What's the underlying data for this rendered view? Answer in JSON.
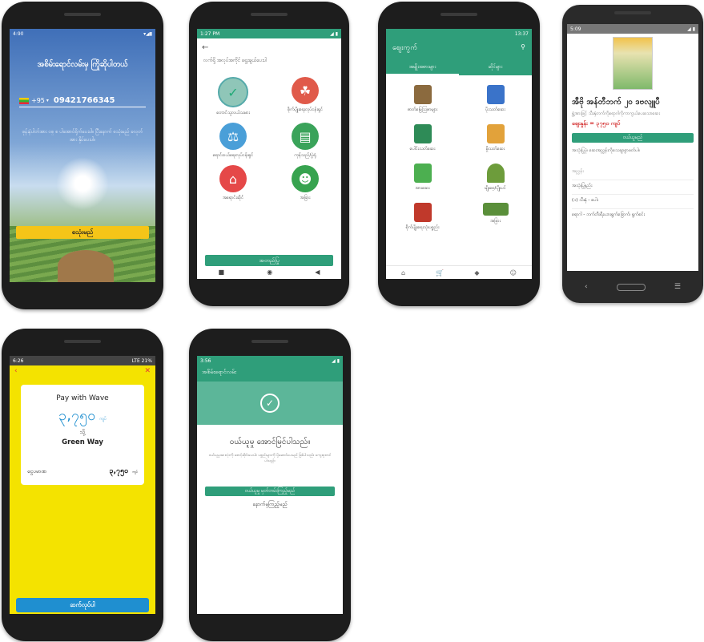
{
  "login": {
    "status_time": "4:90",
    "title": "အစိမ်းရောင်လမ်းမှ ကြိုဆိုပါတယ်",
    "country_code": "+95",
    "phone_number": "09421766345",
    "instructions": "ဖုန်းနံပါတ်အား ဝစ္ စ ပါအောင်ရိုက်ပေးပါ။ ပြီးနောက် စသုံးမည် ခလုတ်အား နှိပ်ပေးပါ။",
    "start_button": "စသုံးမည်"
  },
  "roles": {
    "status_time": "1:27 PM",
    "prompt": "လက်ရှိ အလုပ်အကိုင် ရွေးချယ်ပေးပါ",
    "items": [
      {
        "label": "တောင်သူလယ်သမား",
        "icon": "farmer-check-icon"
      },
      {
        "label": "စိုက်ပျိုးရေးလုပ်ငန်းရှင်",
        "icon": "agri-business-icon"
      },
      {
        "label": "ရောင်းဝယ်ရေးလုပ်ငန်းရှင်",
        "icon": "trader-icon"
      },
      {
        "label": "ကုန်သည်/ပွဲရုံ",
        "icon": "merchant-icon"
      },
      {
        "label": "အရောင်းဆိုင်",
        "icon": "shop-icon"
      },
      {
        "label": "အခြား",
        "icon": "person-icon"
      }
    ],
    "confirm_button": "အတည်ပြု"
  },
  "market": {
    "status_time": "13:37",
    "title": "ဈေးကွက်",
    "tabs": [
      "အမျိုးအစားများ",
      "ဆိုင်များ"
    ],
    "items": [
      {
        "label": "ဓာတ်မြေဩဇာများ",
        "color": "#8b6a3e"
      },
      {
        "label": "ပိုးသတ်ဆေး",
        "color": "#3a73c9"
      },
      {
        "label": "ပေါင်းသတ်ဆေး",
        "color": "#2e8b57"
      },
      {
        "label": "မှိုသတ်ဆေး",
        "color": "#e2a23a"
      },
      {
        "label": "အားဆေး",
        "color": "#4caf50"
      },
      {
        "label": "မျိုးစေ့/ပျိုးပင်",
        "color": "#6d9c3b"
      },
      {
        "label": "စိုက်ပျိုးရေးသုံးပစ္စည်း",
        "color": "#c0392b"
      },
      {
        "label": "အခြား",
        "color": "#5a8f3a"
      }
    ]
  },
  "product": {
    "status_time": "5:09",
    "name": "အီဗို အန်တီဘက် ၂၀ ဒဗလျူပီ",
    "desc": "ရွှံ့အားဖြင့် သီးနှံတက်ကိုရောဂါကိုကာကွယ်ပေးသောဆေး",
    "price": "စျေးနှုန်း = ၃၇၅၀ ကျပ်",
    "buy_button": "ဝယ်ယူမည်",
    "note": "အသုံးပြုပုံ၊ ဆေးအညွှန်းကိုသေချာစွာဖတ်ပါ။",
    "detail_heading": "အညွှန်း",
    "detail_rows": [
      "အသုံးပြုနည်း",
      "(၁) သီးနှံ - စပါး",
      "ရောဂါ - ဘက်တီးရီးယားရွက်ခြောက်၊ ရွက်စင်း"
    ]
  },
  "payment": {
    "status_time": "6:26",
    "status_right": "LTE 21%",
    "pay_with": "Pay with Wave",
    "amount": "၃,၇၅၀",
    "amount_unit": "ကျပ်",
    "to_label": "သို့",
    "merchant": "Green Way",
    "total_label": "ငွေပမာဏ",
    "total_value": "၃,၇၅၀",
    "total_unit": "ကျပ်",
    "continue_button": "ဆက်လုပ်ပါ"
  },
  "success": {
    "status_time": "3:56",
    "header": "အစိမ်းရောင်လမ်း",
    "title": "ဝယ်ယူမှု အောင်မြင်ပါသည်။",
    "message": "ဝယ်ယူမှုအားလုံးကို စောင့်ဆိုင်းပေးပါ။ ပစ္စည်းများကို ပို့ဆောင်ပေးမည် ဖြစ်ပါသည်။ ကျေးဇူးတင်ပါသည်။",
    "details_button": "ဝယ်ယူမှု မှတ်တမ်းကြည့်မည်",
    "continue_link": "နောက်မှကြည့်မည်"
  },
  "colors": {
    "green": "#2f9e7a",
    "yellow": "#f4e300",
    "wave_blue": "#1f8fd0",
    "price_red": "#d32f2f"
  }
}
